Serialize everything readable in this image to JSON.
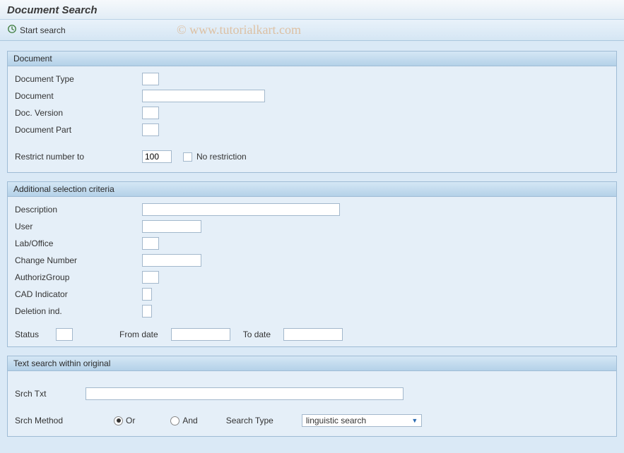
{
  "header": {
    "title": "Document Search"
  },
  "toolbar": {
    "start_search": "Start search"
  },
  "watermark": "© www.tutorialkart.com",
  "groups": {
    "document": {
      "title": "Document",
      "doc_type_label": "Document Type",
      "doc_type_value": "",
      "document_label": "Document",
      "document_value": "",
      "doc_version_label": "Doc. Version",
      "doc_version_value": "",
      "doc_part_label": "Document Part",
      "doc_part_value": "",
      "restrict_label": "Restrict number to",
      "restrict_value": "100",
      "no_restrict_label": "No restriction",
      "no_restrict_checked": false
    },
    "additional": {
      "title": "Additional selection criteria",
      "description_label": "Description",
      "description_value": "",
      "user_label": "User",
      "user_value": "",
      "lab_label": "Lab/Office",
      "lab_value": "",
      "change_label": "Change Number",
      "change_value": "",
      "authgrp_label": "AuthorizGroup",
      "authgrp_value": "",
      "cad_label": "CAD Indicator",
      "cad_value": "",
      "delind_label": "Deletion ind.",
      "delind_value": "",
      "status_label": "Status",
      "status_value": "",
      "from_date_label": "From date",
      "from_date_value": "",
      "to_date_label": "To date",
      "to_date_value": ""
    },
    "textsearch": {
      "title": "Text search within original",
      "srch_txt_label": "Srch Txt",
      "srch_txt_value": "",
      "srch_method_label": "Srch Method",
      "or_label": "Or",
      "and_label": "And",
      "method_selected": "or",
      "search_type_label": "Search Type",
      "search_type_value": "linguistic search"
    }
  }
}
